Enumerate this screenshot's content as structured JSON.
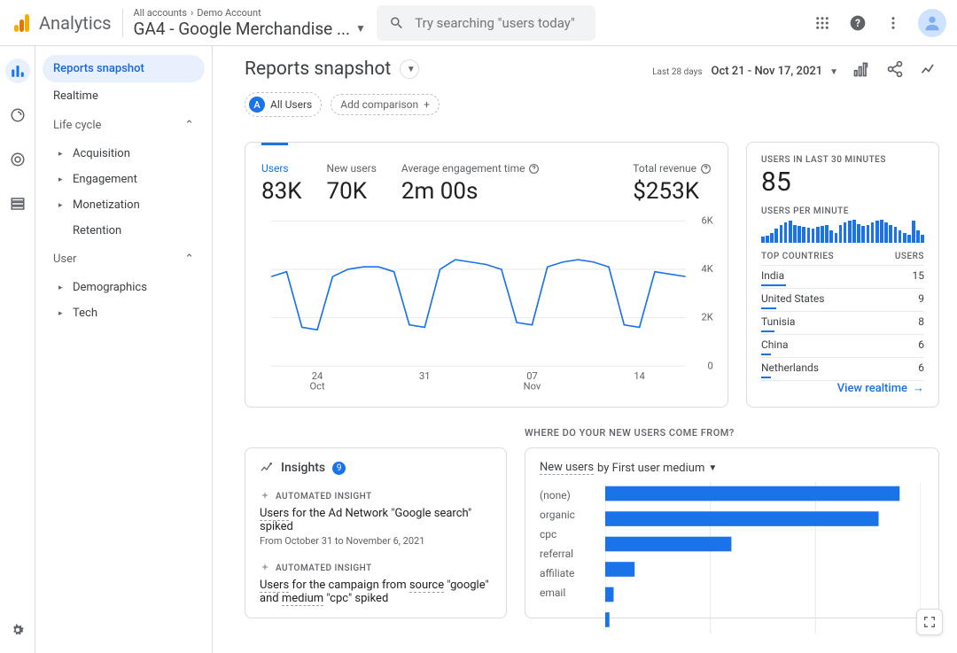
{
  "header": {
    "product": "Analytics",
    "breadcrumb_root": "All accounts",
    "breadcrumb_account": "Demo Account",
    "property": "GA4 - Google Merchandise ...",
    "search_placeholder": "Try searching \"users today\""
  },
  "nav": {
    "reports_snapshot": "Reports snapshot",
    "realtime": "Realtime",
    "life_cycle": "Life cycle",
    "acquisition": "Acquisition",
    "engagement": "Engagement",
    "monetization": "Monetization",
    "retention": "Retention",
    "user": "User",
    "demographics": "Demographics",
    "tech": "Tech"
  },
  "title": {
    "page": "Reports snapshot",
    "date_prefix": "Last 28 days",
    "date_range": "Oct 21 - Nov 17, 2021"
  },
  "chips": {
    "audience": "All Users",
    "audience_badge": "A",
    "add_compare": "Add comparison"
  },
  "metrics": {
    "users_label": "Users",
    "users_value": "83K",
    "new_users_label": "New users",
    "new_users_value": "70K",
    "aet_label": "Average engagement time",
    "aet_value": "2m 00s",
    "rev_label": "Total revenue",
    "rev_value": "$253K"
  },
  "realtime": {
    "label1": "USERS IN LAST 30 MINUTES",
    "value": "85",
    "label2": "USERS PER MINUTE",
    "col1": "TOP COUNTRIES",
    "col2": "USERS",
    "countries": [
      {
        "name": "India",
        "users": "15"
      },
      {
        "name": "United States",
        "users": "9"
      },
      {
        "name": "Tunisia",
        "users": "8"
      },
      {
        "name": "China",
        "users": "6"
      },
      {
        "name": "Netherlands",
        "users": "6"
      }
    ],
    "link": "View realtime"
  },
  "section_q": "WHERE DO YOUR NEW USERS COME FROM?",
  "insights": {
    "title": "Insights",
    "count": "9",
    "tag": "AUTOMATED INSIGHT",
    "items": [
      {
        "title_pre": "Users",
        "title_rest": " for the Ad Network \"Google search\" spiked",
        "sub": "From October 31 to November 6, 2021"
      },
      {
        "title_pre": "Users",
        "title_rest": " for the campaign from ",
        "title_mid": "source",
        "title_rest2": " \"google\" and ",
        "title_mid2": "medium",
        "title_rest3": " \"cpc\" spiked",
        "sub": ""
      }
    ]
  },
  "acq": {
    "metric": "New users",
    "by": " by First user medium",
    "rows": [
      "(none)",
      "organic",
      "cpc",
      "referral",
      "affiliate",
      "email"
    ]
  },
  "chart_data": {
    "type": "multi",
    "main_trend": {
      "type": "line",
      "title": "Users",
      "ylim": [
        0,
        6000
      ],
      "yticks": [
        0,
        2000,
        4000,
        6000
      ],
      "xticks": [
        "24 Oct",
        "31",
        "07 Nov",
        "14"
      ],
      "x": [
        "Oct 21",
        "Oct 22",
        "Oct 23",
        "Oct 24",
        "Oct 25",
        "Oct 26",
        "Oct 27",
        "Oct 28",
        "Oct 29",
        "Oct 30",
        "Oct 31",
        "Nov 1",
        "Nov 2",
        "Nov 3",
        "Nov 4",
        "Nov 5",
        "Nov 6",
        "Nov 7",
        "Nov 8",
        "Nov 9",
        "Nov 10",
        "Nov 11",
        "Nov 12",
        "Nov 13",
        "Nov 14",
        "Nov 15",
        "Nov 16",
        "Nov 17"
      ],
      "values": [
        3700,
        3900,
        1600,
        1500,
        3700,
        4000,
        4100,
        4100,
        3900,
        1700,
        1600,
        4000,
        4400,
        4300,
        4200,
        4000,
        1800,
        1700,
        4100,
        4300,
        4400,
        4300,
        4100,
        1700,
        1600,
        3900,
        3800,
        3700
      ]
    },
    "users_per_minute": {
      "type": "bar",
      "values": [
        6,
        7,
        10,
        14,
        18,
        20,
        22,
        18,
        17,
        16,
        15,
        14,
        16,
        17,
        18,
        12,
        10,
        18,
        20,
        22,
        23,
        19,
        17,
        18,
        20,
        22,
        23,
        20,
        18,
        16,
        12,
        10,
        8,
        22,
        12,
        8
      ]
    },
    "top_countries": {
      "type": "bar",
      "categories": [
        "India",
        "United States",
        "Tunisia",
        "China",
        "Netherlands"
      ],
      "values": [
        15,
        9,
        8,
        6,
        6
      ]
    },
    "new_users_by_medium": {
      "type": "bar",
      "categories": [
        "(none)",
        "organic",
        "cpc",
        "referral",
        "affiliate",
        "email"
      ],
      "values": [
        28000,
        26000,
        12000,
        2800,
        800,
        400
      ],
      "xlim": [
        0,
        30000
      ]
    }
  }
}
